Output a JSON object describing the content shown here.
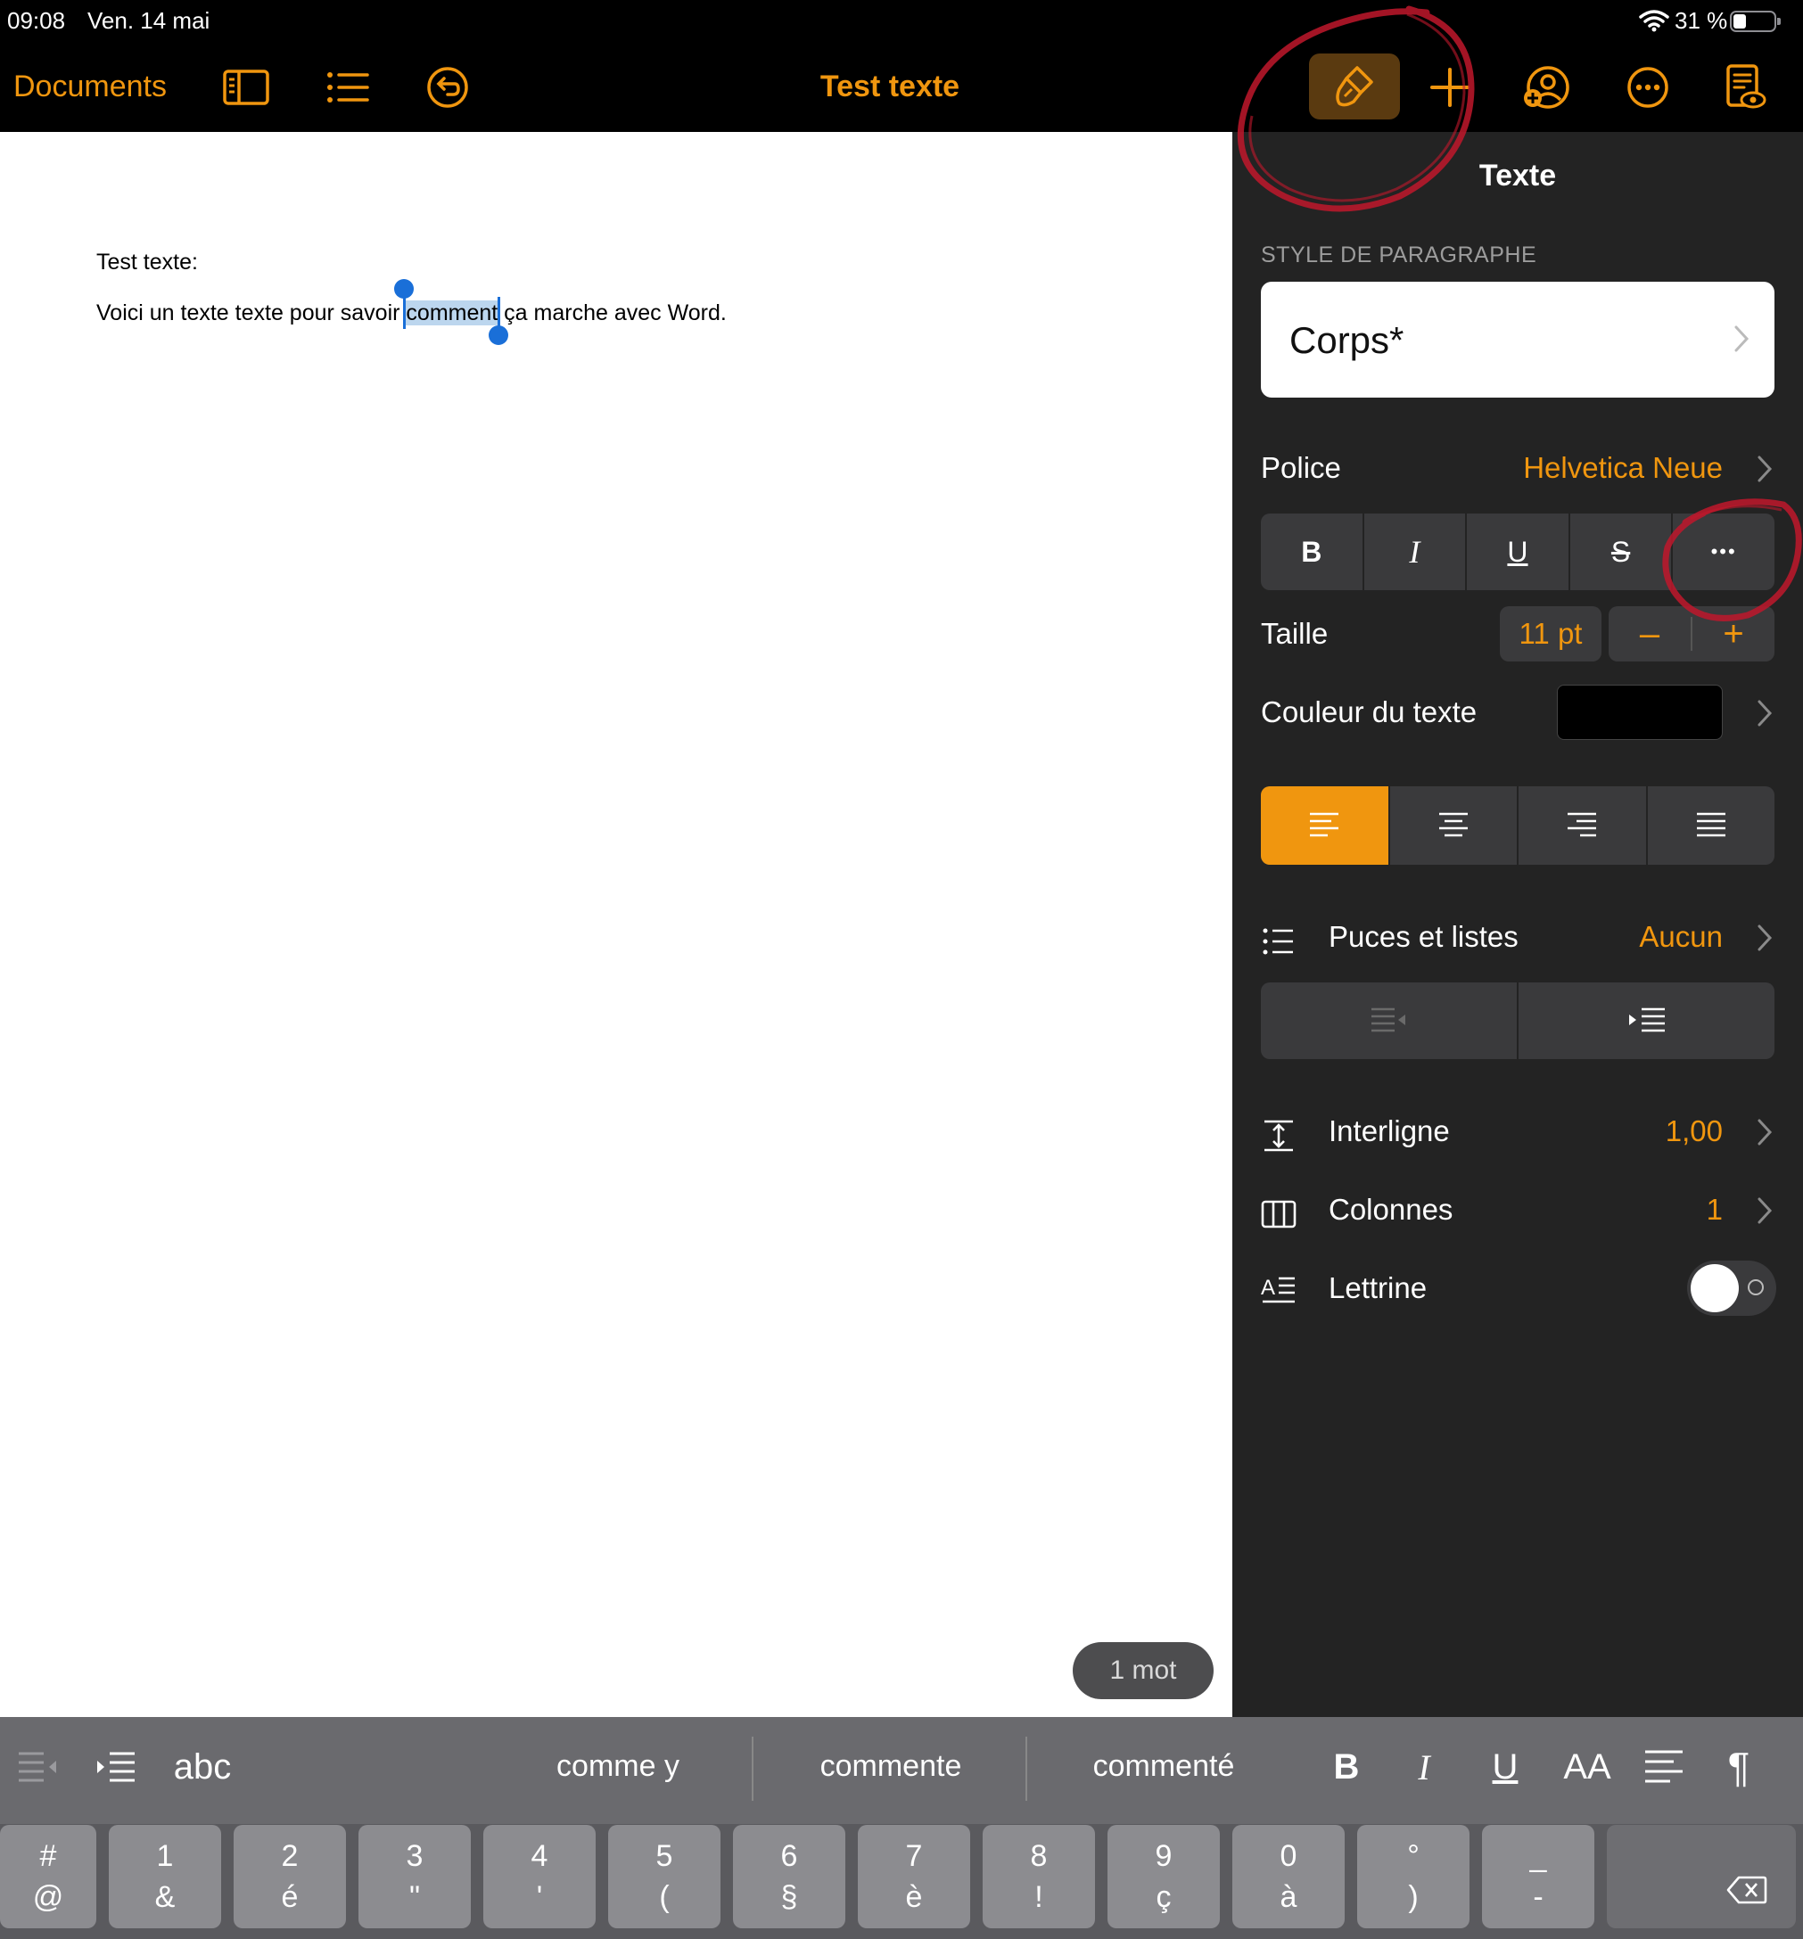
{
  "status_bar": {
    "time": "09:08",
    "date": "Ven. 14 mai",
    "battery": "31 %"
  },
  "toolbar": {
    "documents": "Documents",
    "title": "Test texte",
    "icons": [
      "sidebar-icon",
      "list-icon",
      "undo-icon",
      "paintbrush-icon",
      "plus-icon",
      "collaborate-icon",
      "more-icon",
      "reader-view-icon"
    ]
  },
  "document": {
    "line1": "Test texte:",
    "line2_before": "Voici un texte texte pour savoir ",
    "line2_selected": "comment",
    "line2_after": " ça marche avec Word.",
    "word_count": "1 mot"
  },
  "panel": {
    "title": "Texte",
    "paragraph_style_label": "STYLE DE PARAGRAPHE",
    "paragraph_style_value": "Corps*",
    "font_label": "Police",
    "font_value": "Helvetica Neue",
    "style_buttons": [
      "B",
      "I",
      "U",
      "S",
      "•••"
    ],
    "size_label": "Taille",
    "size_value": "11 pt",
    "size_minus": "–",
    "size_plus": "+",
    "color_label": "Couleur du texte",
    "color_value": "#000000",
    "alignment_active": "left",
    "bullets_label": "Puces et listes",
    "bullets_value": "Aucun",
    "line_spacing_label": "Interligne",
    "line_spacing_value": "1,00",
    "columns_label": "Colonnes",
    "columns_value": "1",
    "drop_cap_label": "Lettrine",
    "drop_cap_on": false
  },
  "accessory_bar": {
    "abc": "abc",
    "suggestions": [
      "comme y",
      "commente",
      "commenté"
    ],
    "bold": "B",
    "italic": "I",
    "underline": "U",
    "font_size": "AA",
    "paragraph": "¶"
  },
  "keyboard": {
    "keys": [
      {
        "top": "#",
        "bottom": "@"
      },
      {
        "top": "1",
        "bottom": "&"
      },
      {
        "top": "2",
        "bottom": "é"
      },
      {
        "top": "3",
        "bottom": "\""
      },
      {
        "top": "4",
        "bottom": "'"
      },
      {
        "top": "5",
        "bottom": "("
      },
      {
        "top": "6",
        "bottom": "§"
      },
      {
        "top": "7",
        "bottom": "è"
      },
      {
        "top": "8",
        "bottom": "!"
      },
      {
        "top": "9",
        "bottom": "ç"
      },
      {
        "top": "0",
        "bottom": "à"
      },
      {
        "top": "°",
        "bottom": ")"
      },
      {
        "top": "_",
        "bottom": "-"
      }
    ]
  },
  "colors": {
    "accent": "#f0960f",
    "panel_bg": "#232323",
    "annotation": "#c0182c"
  }
}
